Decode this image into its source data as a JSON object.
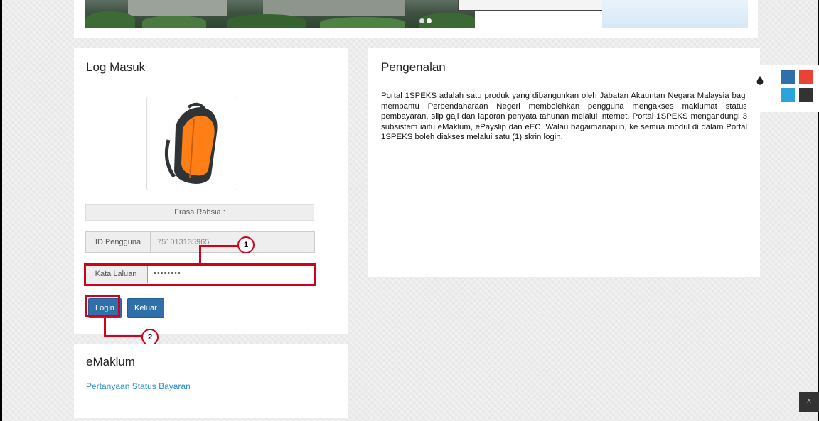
{
  "login": {
    "title": "Log Masuk",
    "frasa_label": "Frasa Rahsia :",
    "id_label": "ID Pengguna",
    "id_value": "751013135965",
    "password_label": "Kata Laluan",
    "password_value": "••••••••",
    "login_button": "Login",
    "keluar_button": "Keluar"
  },
  "intro": {
    "title": "Pengenalan",
    "body": "Portal 1SPEKS adalah satu produk yang dibangunkan oleh Jabatan Akauntan Negara Malaysia bagi membantu Perbendaharaan Negeri membolehkan pengguna mengakses maklumat status pembayaran, slip gaji dan laporan penyata tahunan melalui internet. Portal 1SPEKS mengandungi 3 subsistem iaitu eMaklum, ePayslip dan eEC. Walau bagaimanapun, ke semua modul di dalam Portal 1SPEKS boleh diakses melalui satu (1) skrin login."
  },
  "emaklum": {
    "title": "eMaklum",
    "link": "Pertanyaan Status Bayaran"
  },
  "callouts": {
    "one": "1",
    "two": "2"
  },
  "theme_widget": {
    "icon": "drop-icon",
    "swatches": [
      "#2f6faa",
      "#ea4335",
      "#2ba3dd",
      "#333333"
    ]
  },
  "scroll_top_icon": "chevron-up-icon",
  "colors": {
    "highlight": "#d0021b",
    "button": "#2f6faa",
    "link": "#2a8fd0"
  }
}
